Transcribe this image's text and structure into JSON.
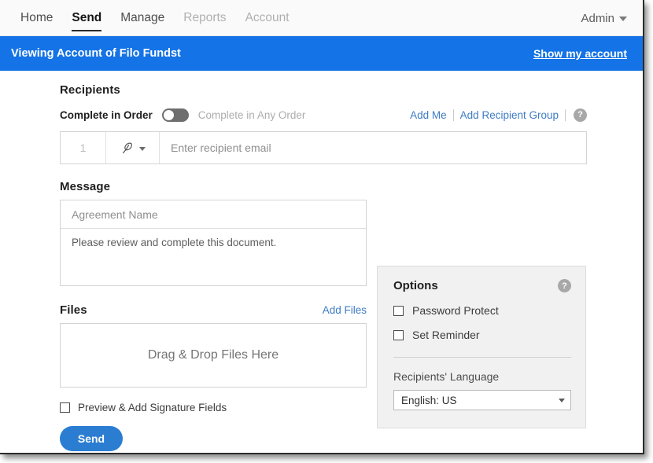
{
  "nav": {
    "items": [
      {
        "label": "Home",
        "state": "normal"
      },
      {
        "label": "Send",
        "state": "active"
      },
      {
        "label": "Manage",
        "state": "normal"
      },
      {
        "label": "Reports",
        "state": "disabled"
      },
      {
        "label": "Account",
        "state": "disabled"
      }
    ],
    "admin_label": "Admin"
  },
  "banner": {
    "prefix": "Viewing Account of ",
    "account": "Filo Fundst",
    "link": "Show my account",
    "color": "#1473e6"
  },
  "recipients": {
    "title": "Recipients",
    "complete_in_order": "Complete in Order",
    "complete_any_order": "Complete in Any Order",
    "toggle_state": "off",
    "add_me": "Add Me",
    "add_recipient_group": "Add Recipient Group",
    "help": "?",
    "row": {
      "number": "1",
      "role_icon": "signature-pen-icon",
      "email_placeholder": "Enter recipient email",
      "email_value": ""
    }
  },
  "message": {
    "title": "Message",
    "agreement_name_placeholder": "Agreement Name",
    "agreement_name_value": "",
    "body_value": "Please review and complete this document."
  },
  "files": {
    "title": "Files",
    "add_files": "Add Files",
    "dropzone": "Drag & Drop Files Here"
  },
  "preview": {
    "label": "Preview & Add Signature Fields",
    "checked": false
  },
  "send": {
    "label": "Send",
    "color": "#2a7dd1"
  },
  "options": {
    "title": "Options",
    "help": "?",
    "password_protect": "Password Protect",
    "password_protect_checked": false,
    "set_reminder": "Set Reminder",
    "set_reminder_checked": false,
    "language_label": "Recipients' Language",
    "language_value": "English: US"
  }
}
